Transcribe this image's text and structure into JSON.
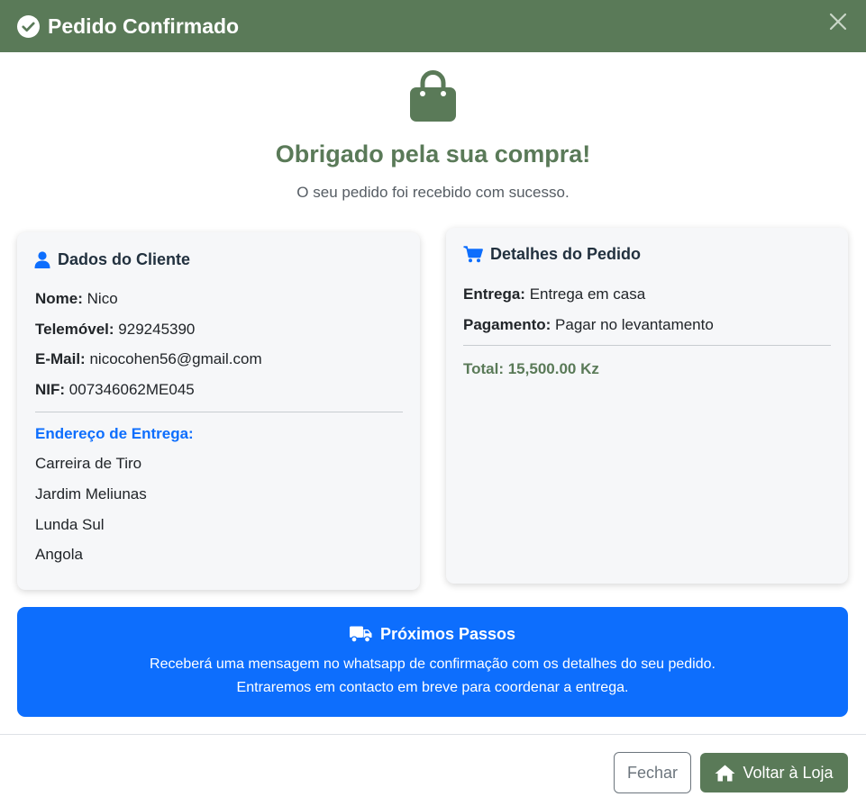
{
  "header": {
    "title": "Pedido Confirmado"
  },
  "hero": {
    "title": "Obrigado pela sua compra!",
    "subtitle": "O seu pedido foi recebido com sucesso."
  },
  "client": {
    "title": "Dados do Cliente",
    "fields": [
      {
        "label": "Nome:",
        "value": "Nico"
      },
      {
        "label": "Telemóvel:",
        "value": "929245390"
      },
      {
        "label": "E-Mail:",
        "value": "nicocohen56@gmail.com"
      },
      {
        "label": "NIF:",
        "value": "007346062ME045"
      }
    ],
    "address_title": "Endereço de Entrega:",
    "address_lines": [
      "Carreira de Tiro",
      "Jardim Meliunas",
      "Lunda Sul",
      "Angola"
    ]
  },
  "order": {
    "title": "Detalhes do Pedido",
    "fields": [
      {
        "label": "Entrega:",
        "value": "Entrega em casa"
      },
      {
        "label": "Pagamento:",
        "value": "Pagar no levantamento"
      }
    ],
    "total": "Total: 15,500.00 Kz"
  },
  "next_steps": {
    "title": "Próximos Passos",
    "line1": "Receberá uma mensagem no whatsapp de confirmação com os detalhes do seu pedido.",
    "line2": "Entraremos em contacto em breve para coordenar a entrega."
  },
  "footer": {
    "close_label": "Fechar",
    "store_label": "Voltar à Loja"
  },
  "colors": {
    "brand_green": "#5a7a58",
    "primary_blue": "#0d6efd",
    "card_bg": "#f6f7f9"
  },
  "icons": {
    "header": "check-circle-icon",
    "close": "close-icon",
    "hero": "shopping-bag-icon",
    "client": "user-icon",
    "order": "cart-icon",
    "next_steps": "truck-icon",
    "store_button": "home-icon"
  }
}
